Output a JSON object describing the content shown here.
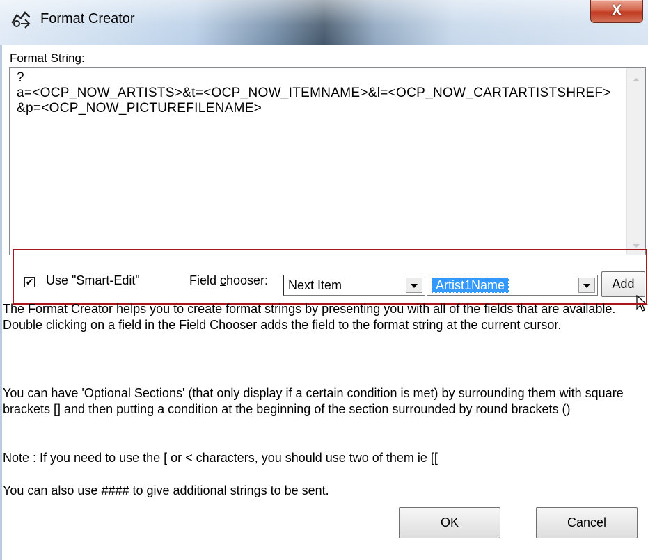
{
  "window": {
    "title": "Format Creator",
    "close_glyph": "X",
    "icon": "format-creator-app-icon"
  },
  "format_string": {
    "label_accel": "F",
    "label_rest": "ormat String:",
    "value": "?\na=<OCP_NOW_ARTISTS>&t=<OCP_NOW_ITEMNAME>&l=<OCP_NOW_CARTARTISTSHREF>&p=<OCP_NOW_PICTUREFILENAME>"
  },
  "options": {
    "smart_edit_checked": true,
    "smart_edit_label": "Use \"Smart-Edit\"",
    "check_glyph": "✔",
    "field_chooser_label_pre": "Field ",
    "field_chooser_label_accel": "c",
    "field_chooser_label_post": "hooser:",
    "combo1_value": "Next Item",
    "combo2_value": "Artist1Name",
    "add_label": "Add"
  },
  "help": {
    "p1": "The Format Creator helps you to create format strings by presenting you with all of the fields that are available. Double clicking on a field in the Field Chooser adds the field to the format string at the current cursor.",
    "p2": "You can have 'Optional Sections' (that only display if a certain condition is met) by surrounding them with square brackets [] and then putting a condition at the beginning of the section surrounded by round brackets ()",
    "p3": "Note : If you need to use the [ or < characters, you should use two of them ie [[",
    "p4": "You can also use #### to give additional strings to be sent."
  },
  "buttons": {
    "ok": "OK",
    "cancel": "Cancel"
  },
  "colors": {
    "highlight_border": "#a9171c",
    "selection": "#3399ff",
    "close_button": "#c0391f"
  }
}
